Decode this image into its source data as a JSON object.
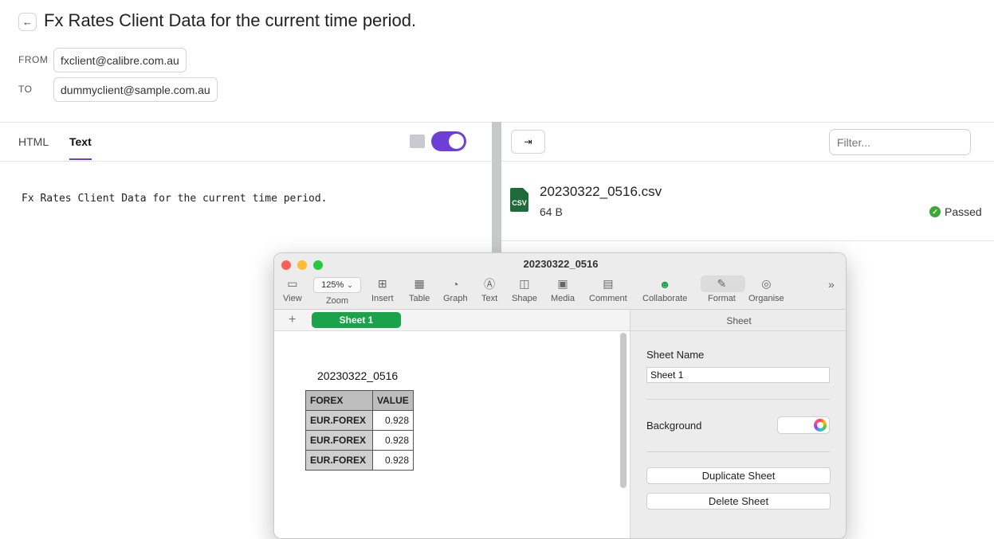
{
  "header": {
    "back_icon": "arrow-left-icon",
    "title": "Fx Rates Client Data for the current time period.",
    "from_label": "FROM",
    "from_value": "fxclient@calibre.com.au",
    "to_label": "TO",
    "to_value": "dummyclient@sample.com.au"
  },
  "left_pane": {
    "tabs": [
      "HTML",
      "Text"
    ],
    "active_tab": "Text",
    "toggle_on": true,
    "accent_color": "#6d3fd6",
    "body_text": "Fx Rates Client Data for the current time period."
  },
  "right_pane": {
    "sidebar_icon": "sidebar-toggle-icon",
    "filter_placeholder": "Filter...",
    "attachment": {
      "icon_label": "CSV",
      "filename": "20230322_0516.csv",
      "size": "64 B",
      "status": "Passed",
      "status_color": "#3aaa35"
    }
  },
  "numbers_window": {
    "title": "20230322_0516",
    "toolbar": {
      "zoom_value": "125%",
      "items": [
        "View",
        "Zoom",
        "Insert",
        "Table",
        "Graph",
        "Text",
        "Shape",
        "Media",
        "Comment",
        "Collaborate",
        "Format",
        "Organise"
      ]
    },
    "sheet_tab": "Sheet 1",
    "table": {
      "title": "20230322_0516",
      "headers": [
        "FOREX",
        "VALUE"
      ],
      "rows": [
        [
          "EUR.FOREX",
          "0.928"
        ],
        [
          "EUR.FOREX",
          "0.928"
        ],
        [
          "EUR.FOREX",
          "0.928"
        ]
      ]
    },
    "inspector": {
      "heading": "Sheet",
      "sheet_name_label": "Sheet Name",
      "sheet_name_value": "Sheet 1",
      "background_label": "Background",
      "duplicate_label": "Duplicate Sheet",
      "delete_label": "Delete Sheet"
    }
  }
}
